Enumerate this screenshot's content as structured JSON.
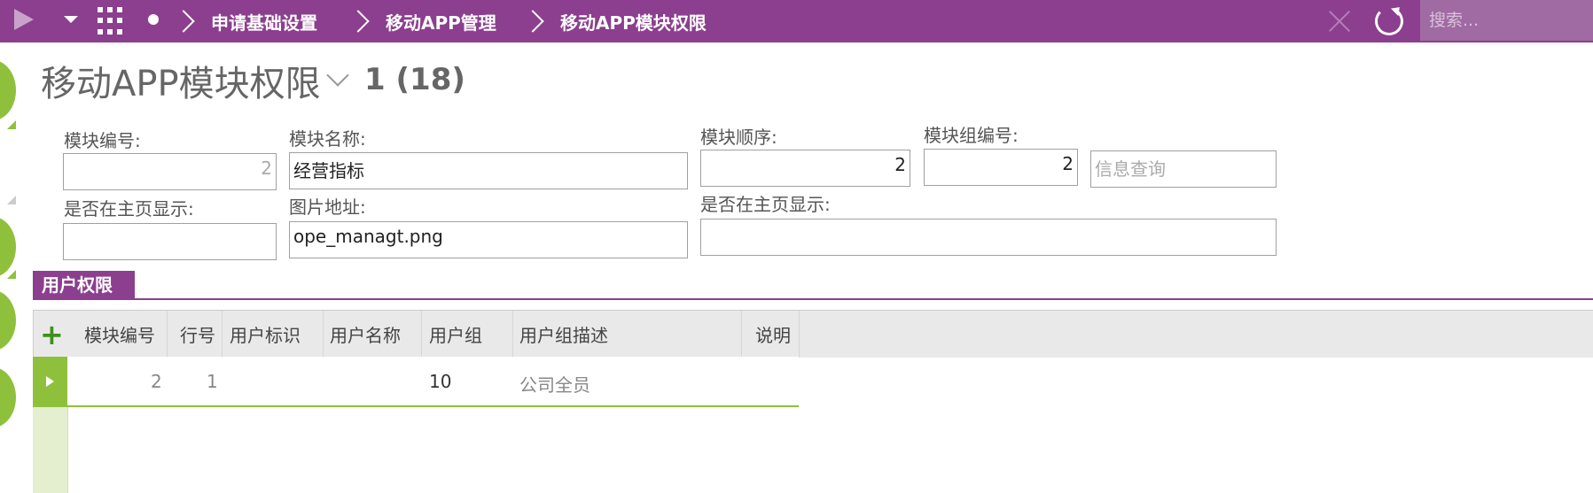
{
  "topbar": {
    "breadcrumbs": [
      "申请基础设置",
      "移动APP管理",
      "移动APP模块权限"
    ],
    "search_placeholder": "搜索..."
  },
  "header": {
    "title": "移动APP模块权限",
    "record_count": "1 (18)"
  },
  "form": {
    "module_no_label": "模块编号:",
    "module_no_value": "2",
    "module_name_label": "模块名称:",
    "module_name_value": "经营指标",
    "module_order_label": "模块顺序:",
    "module_order_value": "2",
    "module_group_label": "模块组编号:",
    "module_group_value": "2",
    "group_desc_value": "信息查询",
    "show_home_label_1": "是否在主页显示:",
    "show_home_value_1": "",
    "image_url_label": "图片地址:",
    "image_url_value": "ope_managt.png",
    "show_home_label_2": "是否在主页显示:",
    "show_home_value_2": ""
  },
  "section": {
    "tab_label": "用户权限"
  },
  "grid": {
    "add_icon": "+",
    "columns": [
      "模块编号",
      "行号",
      "用户标识",
      "用户名称",
      "用户组",
      "用户组描述",
      "说明"
    ],
    "rows": [
      {
        "module_no": "2",
        "line_no": "1",
        "user_id": "",
        "user_name": "",
        "user_group": "10",
        "group_desc": "公司全员",
        "note": ""
      }
    ]
  },
  "colors": {
    "accent": "#8b3f8e",
    "green": "#8fc03c"
  }
}
